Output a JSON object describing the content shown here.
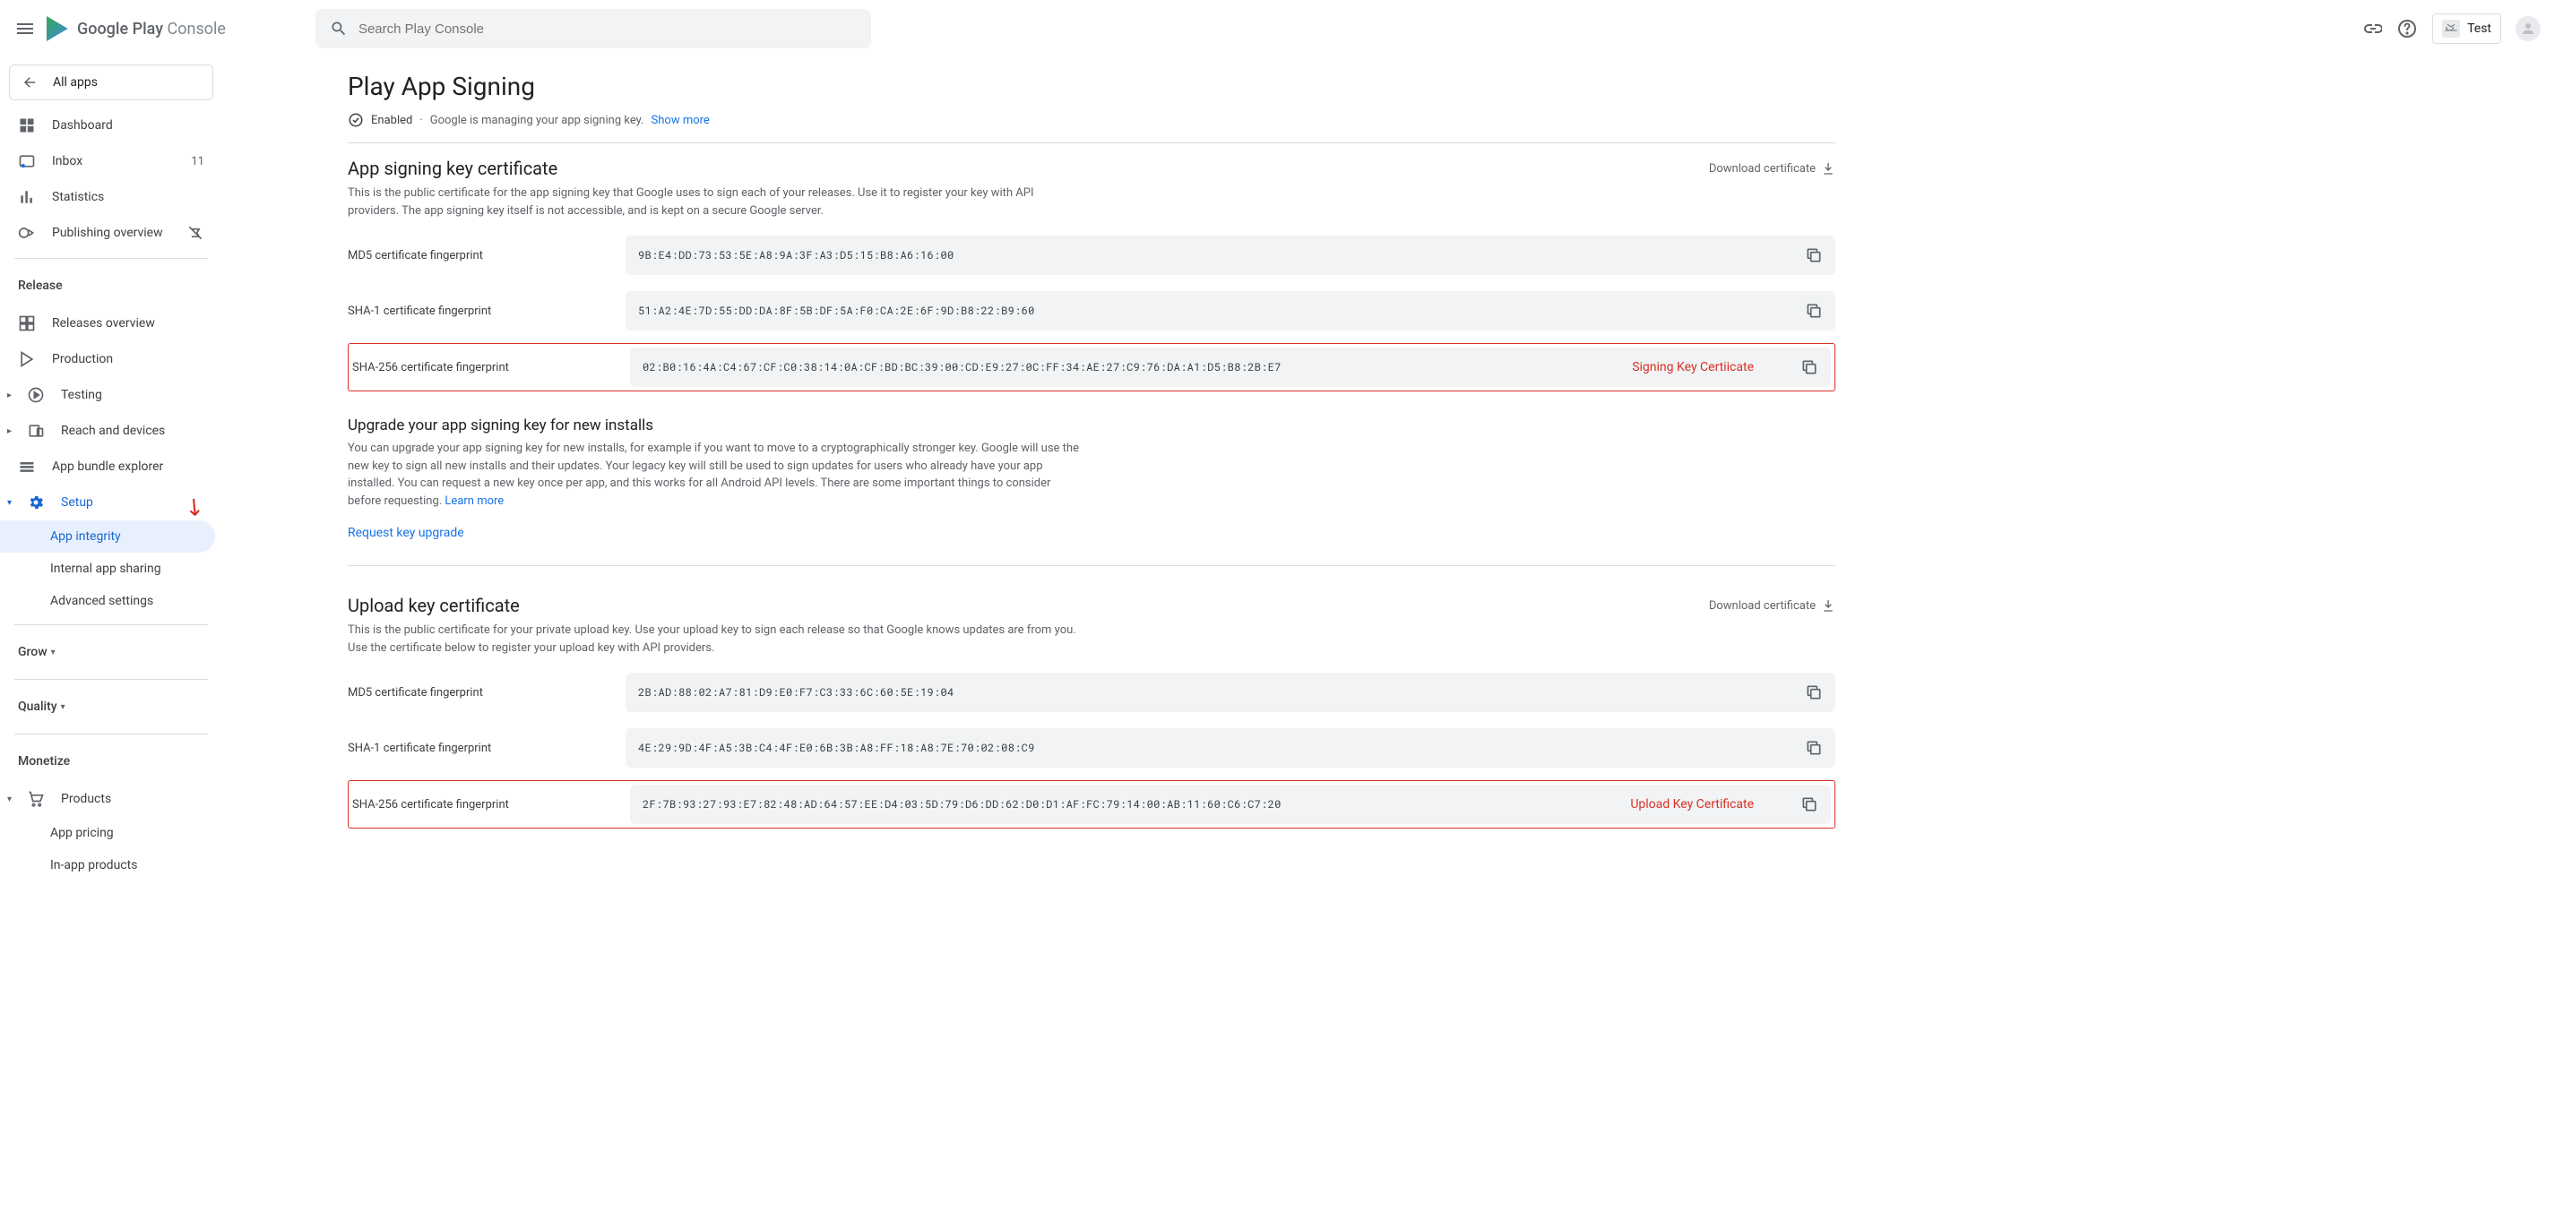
{
  "header": {
    "brand_primary": "Google Play",
    "brand_secondary": "Console",
    "search_placeholder": "Search Play Console",
    "app_name": "Test"
  },
  "sidebar": {
    "all_apps": "All apps",
    "dashboard": "Dashboard",
    "inbox": "Inbox",
    "inbox_count": "11",
    "statistics": "Statistics",
    "publishing": "Publishing overview",
    "release_header": "Release",
    "releases_overview": "Releases overview",
    "production": "Production",
    "testing": "Testing",
    "reach": "Reach and devices",
    "bundle_explorer": "App bundle explorer",
    "setup": "Setup",
    "app_integrity": "App integrity",
    "internal_sharing": "Internal app sharing",
    "advanced": "Advanced settings",
    "grow": "Grow",
    "quality": "Quality",
    "monetize": "Monetize",
    "products": "Products",
    "app_pricing": "App pricing",
    "inapp": "In-app products"
  },
  "page": {
    "title": "Play App Signing",
    "enabled": "Enabled",
    "status_text": "Google is managing your app signing key.",
    "show_more": "Show more",
    "download_cert": "Download certificate",
    "signing": {
      "heading": "App signing key certificate",
      "desc": "This is the public certificate for the app signing key that Google uses to sign each of your releases. Use it to register your key with API providers. The app signing key itself is not accessible, and is kept on a secure Google server.",
      "md5_label": "MD5 certificate fingerprint",
      "md5_value": "9B:E4:DD:73:53:5E:A8:9A:3F:A3:D5:15:B8:A6:16:00",
      "sha1_label": "SHA-1 certificate fingerprint",
      "sha1_value": "51:A2:4E:7D:55:DD:DA:8F:5B:DF:5A:F0:CA:2E:6F:9D:B8:22:B9:60",
      "sha256_label": "SHA-256 certificate fingerprint",
      "sha256_value": "02:B0:16:4A:C4:67:CF:C0:38:14:0A:CF:BD:BC:39:00:CD:E9:27:0C:FF:34:AE:27:C9:76:DA:A1:D5:B8:2B:E7",
      "annotation": "Signing Key Certiicate"
    },
    "upgrade": {
      "heading": "Upgrade your app signing key for new installs",
      "desc": "You can upgrade your app signing key for new installs, for example if you want to move to a cryptographically stronger key. Google will use the new key to sign all new installs and their updates. Your legacy key will still be used to sign updates for users who already have your app installed. You can request a new key once per app, and this works for all Android API levels. There are some important things to consider before requesting.",
      "learn_more": "Learn more",
      "request": "Request key upgrade"
    },
    "upload": {
      "heading": "Upload key certificate",
      "desc": "This is the public certificate for your private upload key. Use your upload key to sign each release so that Google knows updates are from you. Use the certificate below to register your upload key with API providers.",
      "md5_label": "MD5 certificate fingerprint",
      "md5_value": "2B:AD:88:02:A7:81:D9:E0:F7:C3:33:6C:60:5E:19:04",
      "sha1_label": "SHA-1 certificate fingerprint",
      "sha1_value": "4E:29:9D:4F:A5:3B:C4:4F:E0:6B:3B:A8:FF:18:A8:7E:70:02:08:C9",
      "sha256_label": "SHA-256 certificate fingerprint",
      "sha256_value": "2F:7B:93:27:93:E7:82:48:AD:64:57:EE:D4:03:5D:79:D6:DD:62:D0:D1:AF:FC:79:14:00:AB:11:60:C6:C7:20",
      "annotation": "Upload Key Certificate"
    }
  }
}
